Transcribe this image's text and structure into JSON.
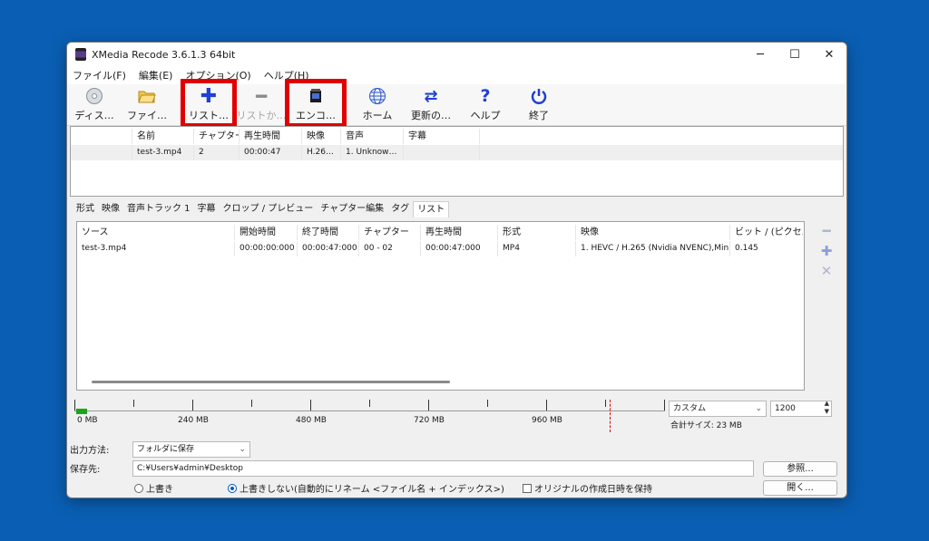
{
  "window": {
    "title": "XMedia Recode 3.6.1.3 64bit"
  },
  "menu": [
    "ファイル(F)",
    "編集(E)",
    "オプション(O)",
    "ヘルプ(H)"
  ],
  "toolbar": {
    "disc": "ディス…",
    "file": "ファイ…",
    "add_list": "リスト…",
    "remove_list": "リストか…",
    "encode": "エンコ…",
    "home": "ホーム",
    "update": "更新の…",
    "help": "ヘルプ",
    "exit": "終了"
  },
  "files_table": {
    "headers": [
      "名前",
      "チャプター",
      "再生時間",
      "映像",
      "音声",
      "字幕"
    ],
    "row": [
      "test-3.mp4",
      "2",
      "00:00:47",
      "H.26…",
      "1. Unknow…",
      ""
    ]
  },
  "tabs": [
    "形式",
    "映像",
    "音声トラック 1",
    "字幕",
    "クロップ / プレビュー",
    "チャプター編集",
    "タグ",
    "リスト"
  ],
  "list_table": {
    "headers": [
      "ソース",
      "開始時間",
      "終了時間",
      "チャプター",
      "再生時間",
      "形式",
      "映像",
      "ビット / (ピクセル*…"
    ],
    "row": [
      "test-3.mp4",
      "00:00:00:000",
      "00:00:47:000",
      "00 - 02",
      "00:00:47:000",
      "MP4",
      "1. HEVC / H.265 (Nvidia NVENC),Min…",
      "0.145"
    ]
  },
  "ruler": {
    "labels": [
      "0 MB",
      "240 MB",
      "480 MB",
      "720 MB",
      "960 MB"
    ],
    "fill_fraction": 0.019
  },
  "size": {
    "preset": "カスタム",
    "value": "1200",
    "total": "合計サイズ: 23 MB"
  },
  "output": {
    "method_label": "出力方法:",
    "method_value": "フォルダに保存",
    "dest_label": "保存先:",
    "dest_value": "C:¥Users¥admin¥Desktop",
    "browse": "参照...",
    "open": "開く...",
    "overwrite": "上書き",
    "no_overwrite": "上書きしない(自動的にリネーム <ファイル名 + インデックス>)",
    "keep_date": "オリジナルの作成日時を保持"
  },
  "colors": {
    "accent": "#0058c8",
    "highlight": "#e00000",
    "progress": "#1aa51a"
  }
}
